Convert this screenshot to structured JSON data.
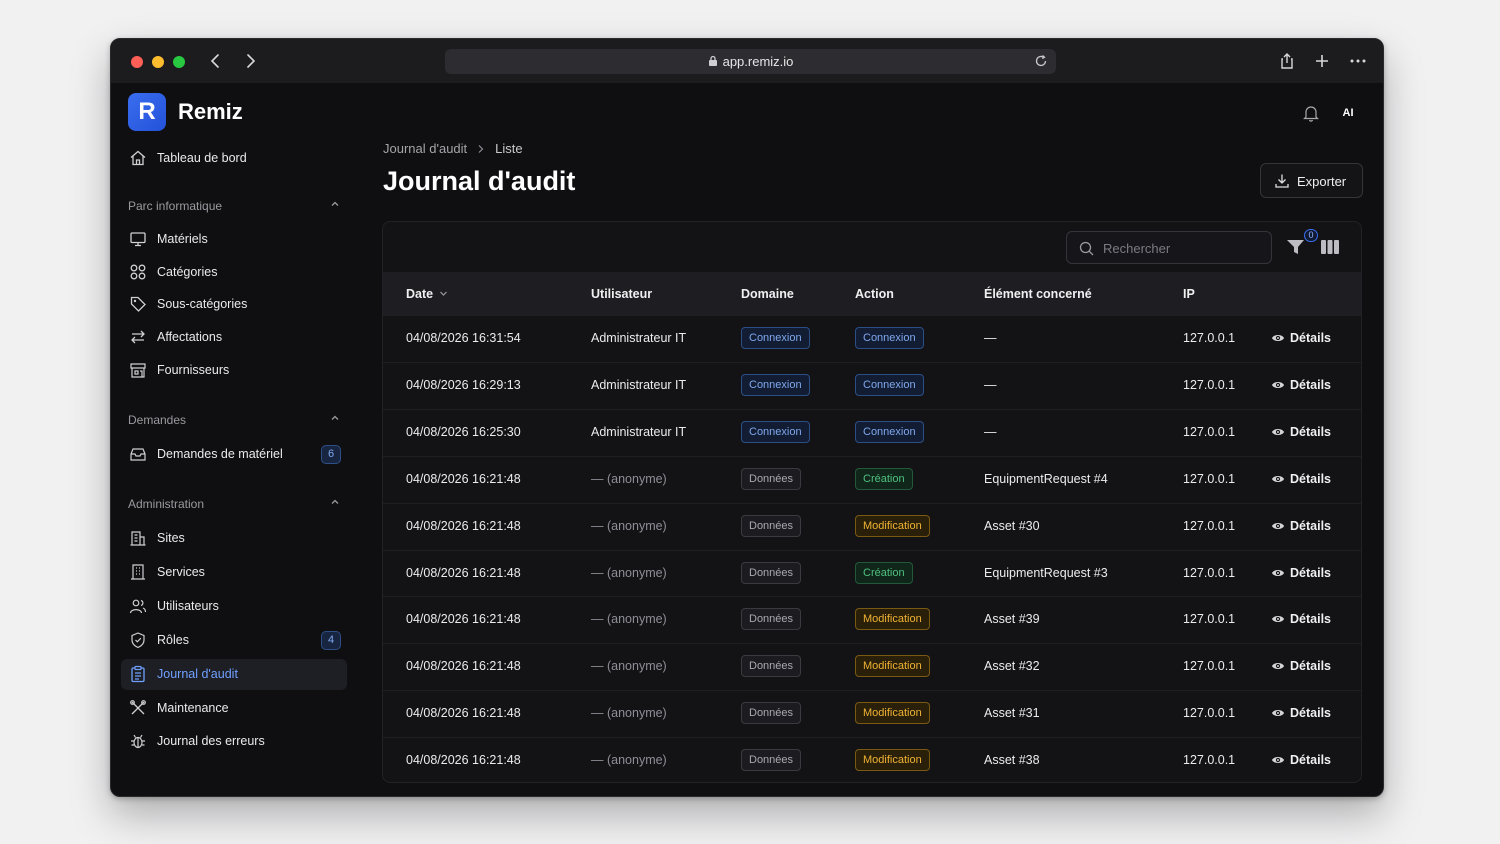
{
  "browser": {
    "url": "app.remiz.io"
  },
  "app": {
    "logo_letter": "R",
    "name": "Remiz",
    "user_initials": "AI"
  },
  "sidebar": {
    "dashboard": {
      "label": "Tableau de bord",
      "icon": "home-icon"
    },
    "sections": [
      {
        "title": "Parc informatique",
        "items": [
          {
            "label": "Matériels",
            "icon": "monitor-icon"
          },
          {
            "label": "Catégories",
            "icon": "grid-icon"
          },
          {
            "label": "Sous-catégories",
            "icon": "tag-icon"
          },
          {
            "label": "Affectations",
            "icon": "swap-icon"
          },
          {
            "label": "Fournisseurs",
            "icon": "store-icon"
          }
        ]
      },
      {
        "title": "Demandes",
        "items": [
          {
            "label": "Demandes de matériel",
            "icon": "inbox-icon",
            "badge": "6"
          }
        ]
      },
      {
        "title": "Administration",
        "items": [
          {
            "label": "Sites",
            "icon": "building-icon"
          },
          {
            "label": "Services",
            "icon": "office-icon"
          },
          {
            "label": "Utilisateurs",
            "icon": "users-icon"
          },
          {
            "label": "Rôles",
            "icon": "shield-icon",
            "badge": "4"
          },
          {
            "label": "Journal d'audit",
            "icon": "clipboard-icon",
            "active": true
          },
          {
            "label": "Maintenance",
            "icon": "wrench-icon"
          },
          {
            "label": "Journal des erreurs",
            "icon": "bug-icon"
          }
        ]
      }
    ]
  },
  "page": {
    "breadcrumb": [
      "Journal d'audit",
      "Liste"
    ],
    "title": "Journal d'audit",
    "export_label": "Exporter",
    "search_placeholder": "Rechercher",
    "filter_count": "0"
  },
  "table": {
    "columns": [
      "Date",
      "Utilisateur",
      "Domaine",
      "Action",
      "Élément concerné",
      "IP"
    ],
    "details_label": "Détails",
    "rows": [
      {
        "date": "04/08/2026 16:31:54",
        "user": "Administrateur IT",
        "domain": "Connexion",
        "domain_style": "blue",
        "action": "Connexion",
        "action_style": "blue",
        "element": "—",
        "ip": "127.0.0.1"
      },
      {
        "date": "04/08/2026 16:29:13",
        "user": "Administrateur IT",
        "domain": "Connexion",
        "domain_style": "blue",
        "action": "Connexion",
        "action_style": "blue",
        "element": "—",
        "ip": "127.0.0.1"
      },
      {
        "date": "04/08/2026 16:25:30",
        "user": "Administrateur IT",
        "domain": "Connexion",
        "domain_style": "blue",
        "action": "Connexion",
        "action_style": "blue",
        "element": "—",
        "ip": "127.0.0.1"
      },
      {
        "date": "04/08/2026 16:21:48",
        "user": "— (anonyme)",
        "domain": "Données",
        "domain_style": "gray",
        "action": "Création",
        "action_style": "green",
        "element": "EquipmentRequest #4",
        "ip": "127.0.0.1"
      },
      {
        "date": "04/08/2026 16:21:48",
        "user": "— (anonyme)",
        "domain": "Données",
        "domain_style": "gray",
        "action": "Modification",
        "action_style": "amber",
        "element": "Asset #30",
        "ip": "127.0.0.1"
      },
      {
        "date": "04/08/2026 16:21:48",
        "user": "— (anonyme)",
        "domain": "Données",
        "domain_style": "gray",
        "action": "Création",
        "action_style": "green",
        "element": "EquipmentRequest #3",
        "ip": "127.0.0.1"
      },
      {
        "date": "04/08/2026 16:21:48",
        "user": "— (anonyme)",
        "domain": "Données",
        "domain_style": "gray",
        "action": "Modification",
        "action_style": "amber",
        "element": "Asset #39",
        "ip": "127.0.0.1"
      },
      {
        "date": "04/08/2026 16:21:48",
        "user": "— (anonyme)",
        "domain": "Données",
        "domain_style": "gray",
        "action": "Modification",
        "action_style": "amber",
        "element": "Asset #32",
        "ip": "127.0.0.1"
      },
      {
        "date": "04/08/2026 16:21:48",
        "user": "— (anonyme)",
        "domain": "Données",
        "domain_style": "gray",
        "action": "Modification",
        "action_style": "amber",
        "element": "Asset #31",
        "ip": "127.0.0.1"
      },
      {
        "date": "04/08/2026 16:21:48",
        "user": "— (anonyme)",
        "domain": "Données",
        "domain_style": "gray",
        "action": "Modification",
        "action_style": "amber",
        "element": "Asset #38",
        "ip": "127.0.0.1"
      }
    ]
  },
  "colors": {
    "accent": "#3a6df0",
    "background": "#0f0f11",
    "tag_blue": "#7fa8ee",
    "tag_green": "#4fc07e",
    "tag_amber": "#f0b233"
  }
}
